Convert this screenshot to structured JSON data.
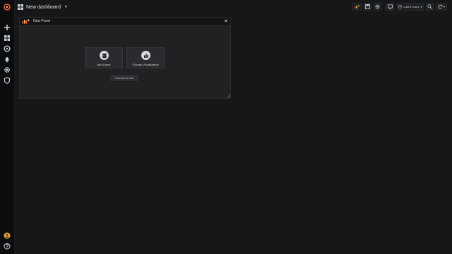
{
  "topbar": {
    "dashboard_title": "New dashboard",
    "time_range": "Last 6 hours"
  },
  "icons": {
    "logo": "grafana-logo-icon",
    "apps": "dashboard-grid-icon",
    "add_panel": "add-panel-icon",
    "save": "save-icon",
    "settings": "gear-icon",
    "tv_mode": "tv-monitor-icon",
    "clock": "clock-icon",
    "zoom_out": "zoom-out-icon",
    "refresh": "refresh-icon"
  },
  "sidebar": {
    "items": [
      {
        "name": "create",
        "icon": "plus-icon"
      },
      {
        "name": "dashboards",
        "icon": "dashboards-icon"
      },
      {
        "name": "explore",
        "icon": "compass-icon"
      },
      {
        "name": "alerting",
        "icon": "bell-icon"
      },
      {
        "name": "configuration",
        "icon": "gear-icon"
      },
      {
        "name": "server-admin",
        "icon": "shield-icon"
      }
    ],
    "bottom": [
      {
        "name": "profile",
        "icon": "avatar-icon"
      },
      {
        "name": "help",
        "icon": "help-icon"
      }
    ]
  },
  "panel": {
    "title": "New Panel",
    "actions": [
      {
        "label": "Add Query",
        "icon": "database-icon"
      },
      {
        "label": "Choose Visualization",
        "icon": "chart-icon"
      }
    ],
    "convert_label": "Convert to row"
  },
  "colors": {
    "background": "#161719",
    "sidebar": "#0b0c0e",
    "panel": "#212124",
    "accent": "#f05a28"
  }
}
